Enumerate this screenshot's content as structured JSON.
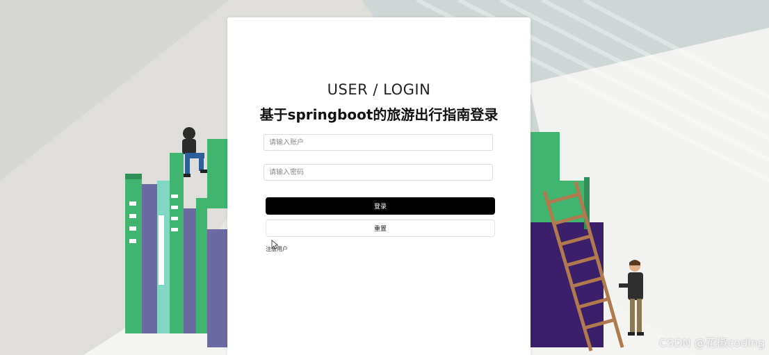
{
  "login": {
    "title_en": "USER / LOGIN",
    "title_cn": "基于springboot的旅游出行指南登录",
    "account_placeholder": "请输入账户",
    "password_placeholder": "请输入密码",
    "login_button": "登录",
    "reset_button": "重置",
    "register_link": "注册用户"
  },
  "watermark": "CSDN @花椒coding",
  "colors": {
    "login_button_bg": "#000000",
    "book_green": "#3fb56f",
    "book_purple": "#6b6aa3",
    "book_dark_purple": "#3b1f6b",
    "ladder": "#b07a4e"
  },
  "icons": [
    "mouse-cursor-icon"
  ]
}
